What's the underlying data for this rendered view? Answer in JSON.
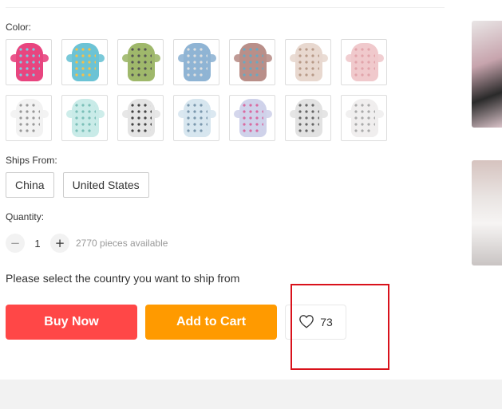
{
  "color_section": {
    "label": "Color:",
    "swatches": [
      {
        "color": "#e8457f",
        "accent": "#7ec8e3"
      },
      {
        "color": "#6cc3d5",
        "accent": "#f5c04a"
      },
      {
        "color": "#9fb86b",
        "accent": "#555555"
      },
      {
        "color": "#8fb4d4",
        "accent": "#e0e0e0"
      },
      {
        "color": "#b98f89",
        "accent": "#67a9c2"
      },
      {
        "color": "#e8d8cf",
        "accent": "#b89a88"
      },
      {
        "color": "#f0c9cc",
        "accent": "#e2a4aa"
      },
      {
        "color": "#f2f2f2",
        "accent": "#999999"
      },
      {
        "color": "#c9ebe8",
        "accent": "#7bbfb8"
      },
      {
        "color": "#e4e4e4",
        "accent": "#444444"
      },
      {
        "color": "#d7e6ef",
        "accent": "#7b98ad"
      },
      {
        "color": "#cfd2ea",
        "accent": "#d96aa0"
      },
      {
        "color": "#e2e2e2",
        "accent": "#666666"
      },
      {
        "color": "#f0eeee",
        "accent": "#aaaaaa"
      }
    ]
  },
  "ships_from": {
    "label": "Ships From:",
    "options": [
      "China",
      "United States"
    ]
  },
  "quantity": {
    "label": "Quantity:",
    "value": "1",
    "minus": "−",
    "plus": "+",
    "available": "2770 pieces available"
  },
  "ship_message": "Please select the country you want to ship from",
  "actions": {
    "buy_now": "Buy Now",
    "add_to_cart": "Add to Cart",
    "wishlist_count": "73",
    "wishlist_icon": "heart-icon"
  },
  "colors": {
    "buy": "#ff4747",
    "cart": "#ff9a00",
    "highlight": "#d9121b"
  }
}
